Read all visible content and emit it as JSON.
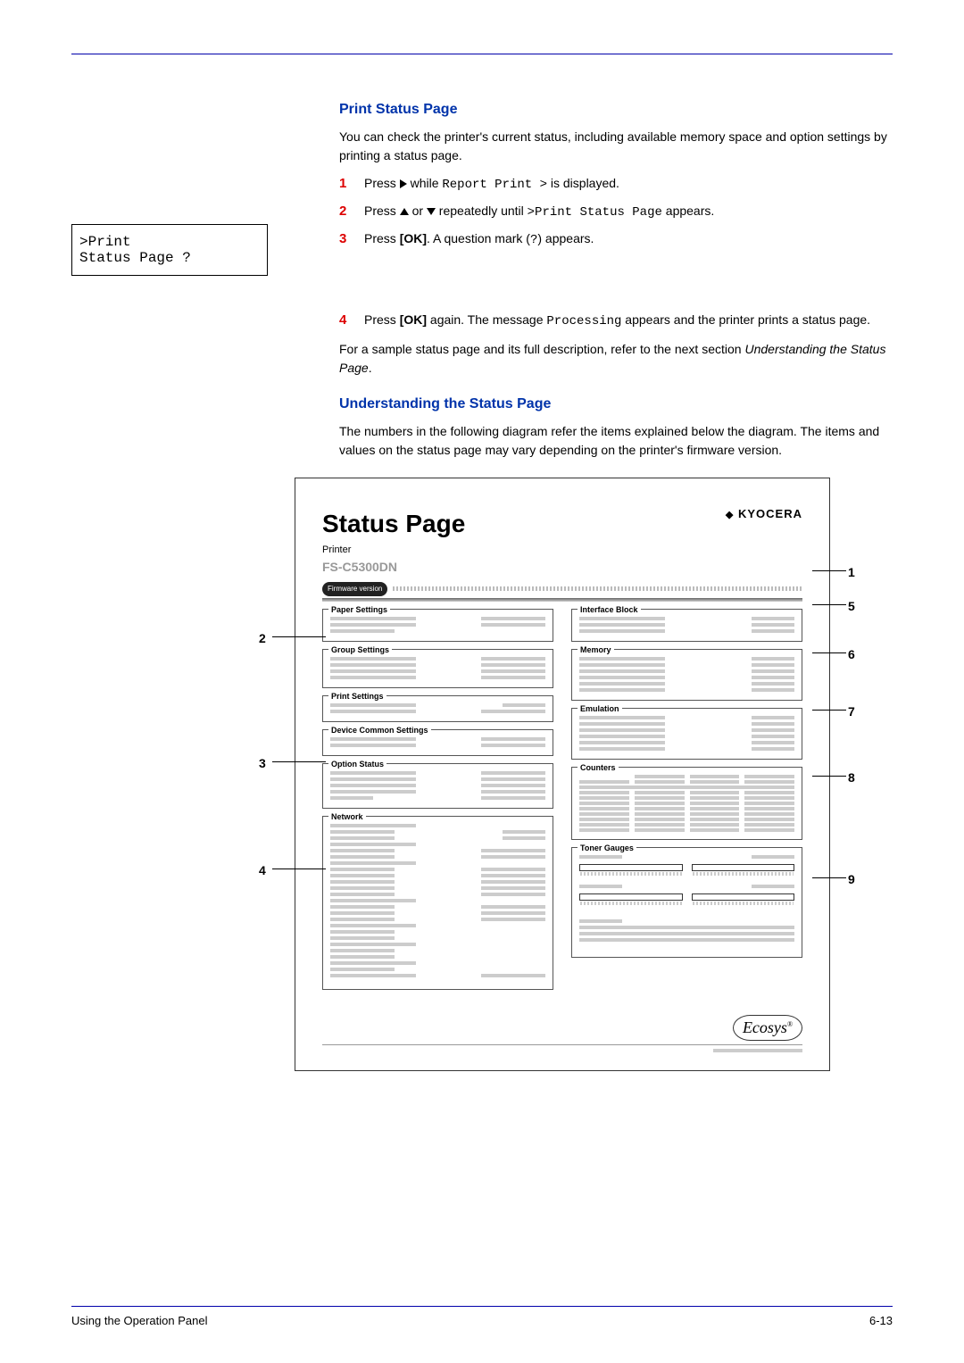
{
  "section": {
    "h1": "Print Status Page",
    "intro": "You can check the printer's current status, including available memory space and option settings by printing a status page.",
    "step1a": "Press ",
    "step1b": " while ",
    "step1_mono": "Report Print >",
    "step1c": " is displayed.",
    "step2a": "Press ",
    "step2b": " or ",
    "step2c": " repeatedly until ",
    "step2_mono": ">Print Status Page",
    "step2d": " appears.",
    "step3a": "Press ",
    "step3_bold": "[OK]",
    "step3b": ". A question mark (",
    "step3_mono": "?",
    "step3c": ") appears.",
    "step4a": "Press ",
    "step4_bold": "[OK]",
    "step4b": " again. The message ",
    "step4_mono": "Processing",
    "step4c": " appears and the printer prints a status page.",
    "after": "For a sample status page and its full description, refer to the next section ",
    "after_i": "Understanding the Status Page",
    "after2": ".",
    "h2": "Understanding the Status Page",
    "intro2": "The numbers in the following diagram refer the items explained below the diagram. The items and values on the status page may vary depending on the printer's firmware version."
  },
  "lcd": {
    "line1": ">Print",
    "line2": " Status Page ?"
  },
  "status_page": {
    "title": "Status Page",
    "sub": "Printer",
    "model": "FS-C5300DN",
    "logo": "KYOCERA",
    "fw": "Firmware version",
    "boxes_left": [
      "Paper Settings",
      "Group Settings",
      "Print Settings",
      "Device Common Settings",
      "Option Status",
      "Network"
    ],
    "boxes_right": [
      "Interface Block",
      "Memory",
      "Emulation",
      "Counters",
      "Toner Gauges"
    ],
    "eco": "Ecosys"
  },
  "callouts": {
    "c1": "1",
    "c2": "2",
    "c3": "3",
    "c4": "4",
    "c5": "5",
    "c6": "6",
    "c7": "7",
    "c8": "8",
    "c9": "9"
  },
  "footer": {
    "left": "Using the Operation Panel",
    "right": "6-13"
  }
}
